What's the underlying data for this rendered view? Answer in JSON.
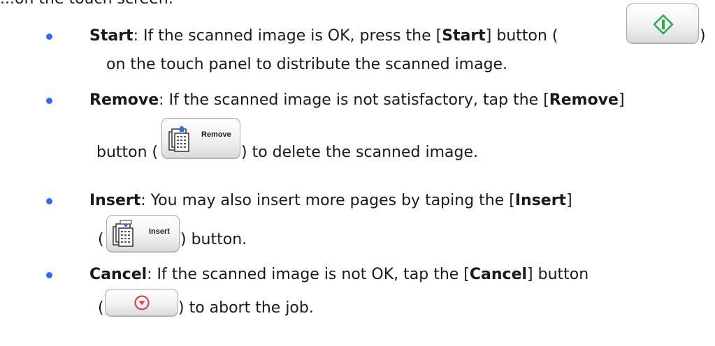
{
  "top_fragment": "...on the touch screen:",
  "items": {
    "start": {
      "term": "Start",
      "text1": ": If the scanned image is OK, press the [",
      "bold": "Start",
      "text2": "] button (",
      "text3": ")",
      "line2": "on the touch panel to distribute the scanned image."
    },
    "remove": {
      "term": "Remove",
      "text1": ": If the scanned image is not satisfactory, tap the [",
      "bold": "Remove",
      "text2": "]",
      "line2_a": "button (",
      "line2_b": ") to delete the scanned image.",
      "button_label": "Remove"
    },
    "insert": {
      "term": "Insert",
      "text1": ": You may also insert more pages by taping the [",
      "bold": "Insert",
      "text2": "]",
      "line2_a": "(",
      "line2_b": ") button.",
      "button_label": "Insert"
    },
    "cancel": {
      "term": "Cancel",
      "text1": ": If the scanned image is not OK, tap the [",
      "bold": "Cancel",
      "text2": "] button",
      "line2_a": "(",
      "line2_b": ") to abort the job."
    }
  },
  "colors": {
    "bullet": "#2b6ef0",
    "start_icon": "#2fa84f",
    "cancel_icon": "#e0404a"
  },
  "icons": [
    "start-diamond-icon",
    "remove-pages-icon",
    "insert-pages-icon",
    "stop-circle-icon"
  ]
}
